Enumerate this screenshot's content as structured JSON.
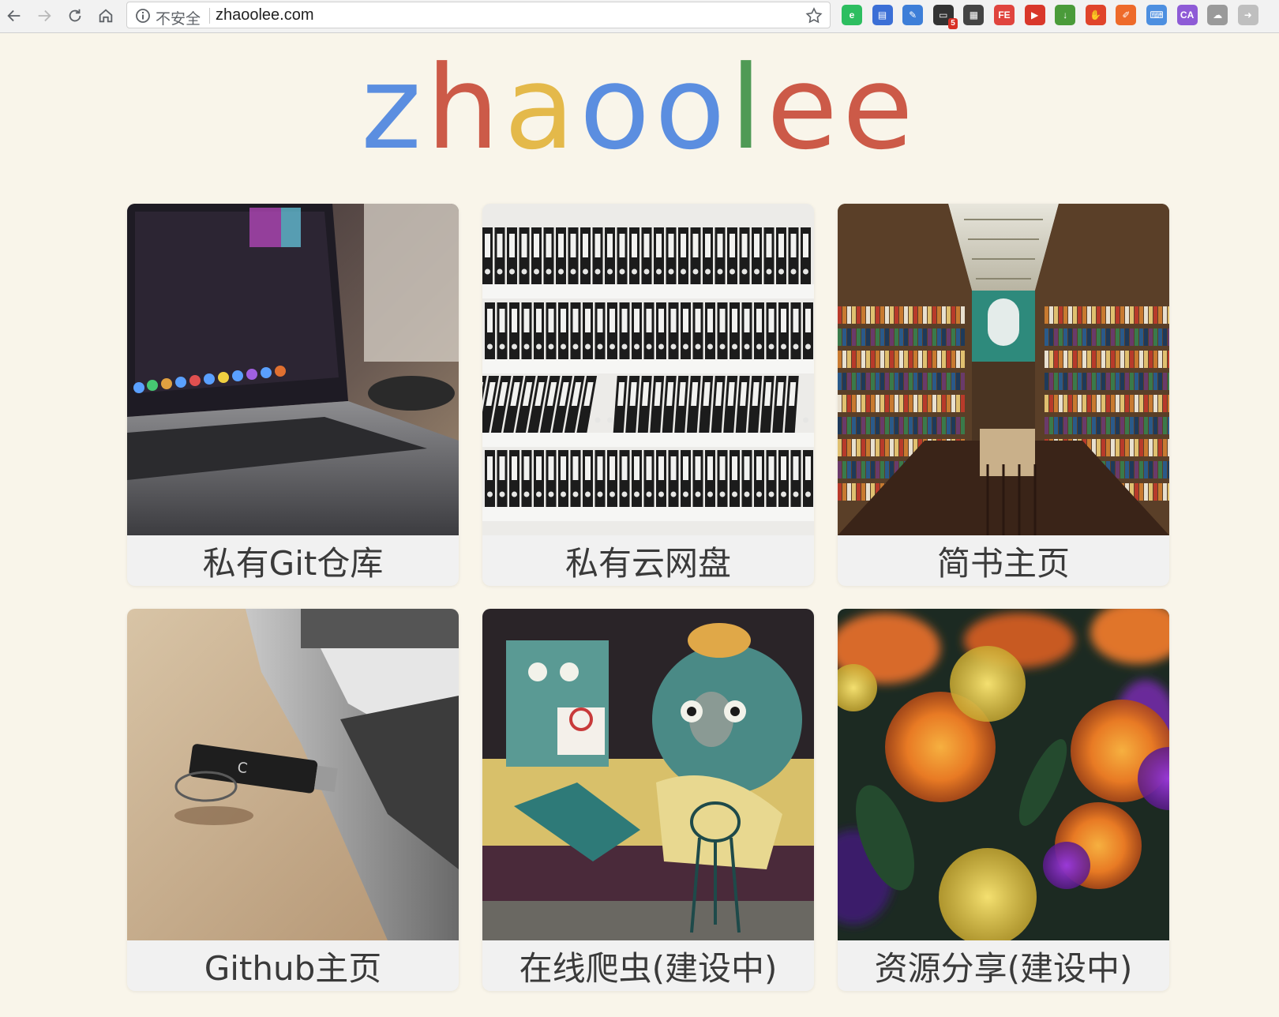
{
  "browser": {
    "security_label": "不安全",
    "url": "zhaoolee.com",
    "extensions": [
      {
        "name": "evernote-icon",
        "color": "#2dbe60",
        "glyph": "e"
      },
      {
        "name": "reader-icon",
        "color": "#3b6fd6",
        "glyph": "▤"
      },
      {
        "name": "translate-icon",
        "color": "#3d7ed8",
        "glyph": "✎"
      },
      {
        "name": "tab-counter-icon",
        "color": "#333333",
        "glyph": "▭",
        "badge": "5"
      },
      {
        "name": "qr-code-icon",
        "color": "#444444",
        "glyph": "▦"
      },
      {
        "name": "fe-helper-icon",
        "color": "#e0443e",
        "glyph": "FE"
      },
      {
        "name": "video-icon",
        "color": "#d9372b",
        "glyph": "▶"
      },
      {
        "name": "download-icon",
        "color": "#4a9b3a",
        "glyph": "↓"
      },
      {
        "name": "adblock-icon",
        "color": "#e0442b",
        "glyph": "✋"
      },
      {
        "name": "blog-icon",
        "color": "#ee6a2a",
        "glyph": "✐"
      },
      {
        "name": "keyboard-icon",
        "color": "#4d8fe0",
        "glyph": "⌨"
      },
      {
        "name": "ca-icon",
        "color": "#8e5bd6",
        "glyph": "CA"
      },
      {
        "name": "brain-icon",
        "color": "#9a9a9a",
        "glyph": "☁"
      },
      {
        "name": "pin-icon",
        "color": "#bfbfbf",
        "glyph": "➜"
      }
    ]
  },
  "logo": {
    "letters": [
      {
        "char": "z",
        "color": "#5b8ee0"
      },
      {
        "char": "h",
        "color": "#cc5a48"
      },
      {
        "char": "a",
        "color": "#e4b94a"
      },
      {
        "char": "o",
        "color": "#5b8ee0"
      },
      {
        "char": "o",
        "color": "#5b8ee0"
      },
      {
        "char": "l",
        "color": "#4f9a55"
      },
      {
        "char": "e",
        "color": "#cc5a48"
      },
      {
        "char": "e",
        "color": "#cc5a48"
      }
    ]
  },
  "cards": [
    {
      "label": "私有Git仓库",
      "image": "laptop-photo"
    },
    {
      "label": "私有云网盘",
      "image": "binders-photo"
    },
    {
      "label": "简书主页",
      "image": "bookstore-photo"
    },
    {
      "label": "Github主页",
      "image": "usb-drive-photo"
    },
    {
      "label": "在线爬虫(建设中)",
      "image": "graffiti-photo"
    },
    {
      "label": "资源分享(建设中)",
      "image": "flowers-photo"
    }
  ]
}
